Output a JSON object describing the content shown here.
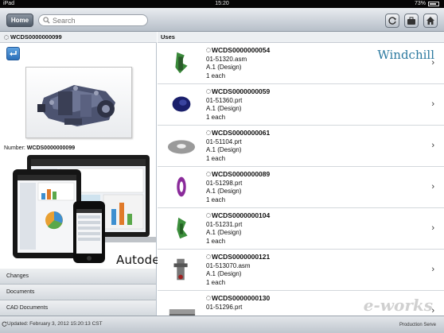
{
  "status_bar": {
    "carrier": "iPad",
    "wifi_icon": "wifi-icon",
    "time": "15:20",
    "battery": "73%"
  },
  "toolbar": {
    "home_label": "Home",
    "search_placeholder": "Search",
    "icons": [
      "refresh-icon",
      "briefcase-icon",
      "home-icon"
    ]
  },
  "left_pane": {
    "title": "WCDS0000000099",
    "number_label": "Number:",
    "number_value": "WCDS0000000099",
    "promo_brand": "Autodesk",
    "items": [
      {
        "label": "Changes"
      },
      {
        "label": "Documents"
      },
      {
        "label": "CAD Documents"
      }
    ]
  },
  "right_pane": {
    "header": "Uses",
    "brand": "Windchill",
    "rows": [
      {
        "number": "WCDS0000000054",
        "file": "01-51320.asm",
        "version": "A.1 (Design)",
        "qty": "1 each",
        "thumb_color": "#3a8a3a"
      },
      {
        "number": "WCDS0000000059",
        "file": "01-51360.prt",
        "version": "A.1 (Design)",
        "qty": "1 each",
        "thumb_color": "#1a1f6b"
      },
      {
        "number": "WCDS0000000061",
        "file": "01-51104.prt",
        "version": "A.1 (Design)",
        "qty": "1 each",
        "thumb_color": "#9a9a9a"
      },
      {
        "number": "WCDS0000000089",
        "file": "01-51298.prt",
        "version": "A.1 (Design)",
        "qty": "1 each",
        "thumb_color": "#8a2a9a"
      },
      {
        "number": "WCDS0000000104",
        "file": "01-51231.prt",
        "version": "A.1 (Design)",
        "qty": "1 each",
        "thumb_color": "#3c8f3c"
      },
      {
        "number": "WCDS0000000121",
        "file": "01-513070.asm",
        "version": "A.1 (Design)",
        "qty": "1 each",
        "thumb_color": "#777777"
      },
      {
        "number": "WCDS0000000130",
        "file": "01-51296.prt",
        "version": "",
        "qty": "",
        "thumb_color": "#999999"
      }
    ]
  },
  "bottom_bar": {
    "updated": "Updated: February 3, 2012 15:20:13 CST",
    "server": "Production Serve"
  },
  "watermark": "e-works"
}
